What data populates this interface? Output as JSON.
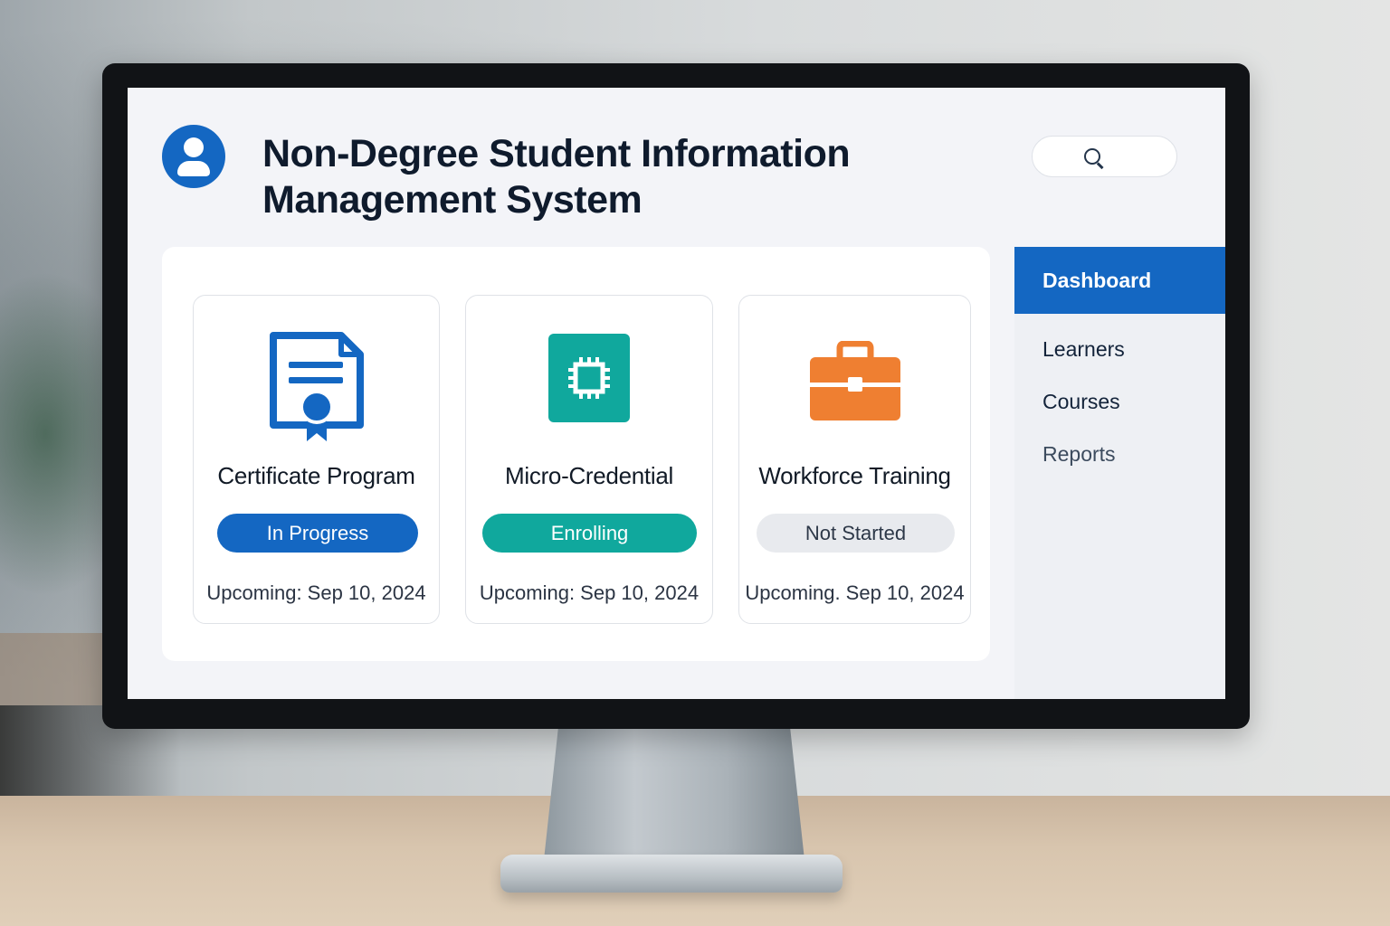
{
  "header": {
    "title": "Non-Degree Student Information Management System"
  },
  "search": {
    "icon": "search-icon"
  },
  "sidebar": {
    "items": [
      {
        "label": "Dashboard",
        "active": true
      },
      {
        "label": "Learners",
        "active": false
      },
      {
        "label": "Courses",
        "active": false
      },
      {
        "label": "Reports",
        "active": false
      }
    ]
  },
  "programs": [
    {
      "title": "Certificate Program",
      "icon": "certificate-icon",
      "status": "In Progress",
      "status_color": "#1467c2",
      "date": "Upcoming: Sep 10, 2024"
    },
    {
      "title": "Micro-Credential",
      "icon": "chip-icon",
      "status": "Enrolling",
      "status_color": "#10a89d",
      "date": "Upcoming: Sep 10, 2024"
    },
    {
      "title": "Workforce Training",
      "icon": "briefcase-icon",
      "status": "Not Started",
      "status_color": "#e8eaee",
      "date": "Upcoming. Sep 10, 2024"
    }
  ],
  "colors": {
    "accent": "#1467c2",
    "teal": "#10a89d",
    "orange": "#ef7f31"
  }
}
